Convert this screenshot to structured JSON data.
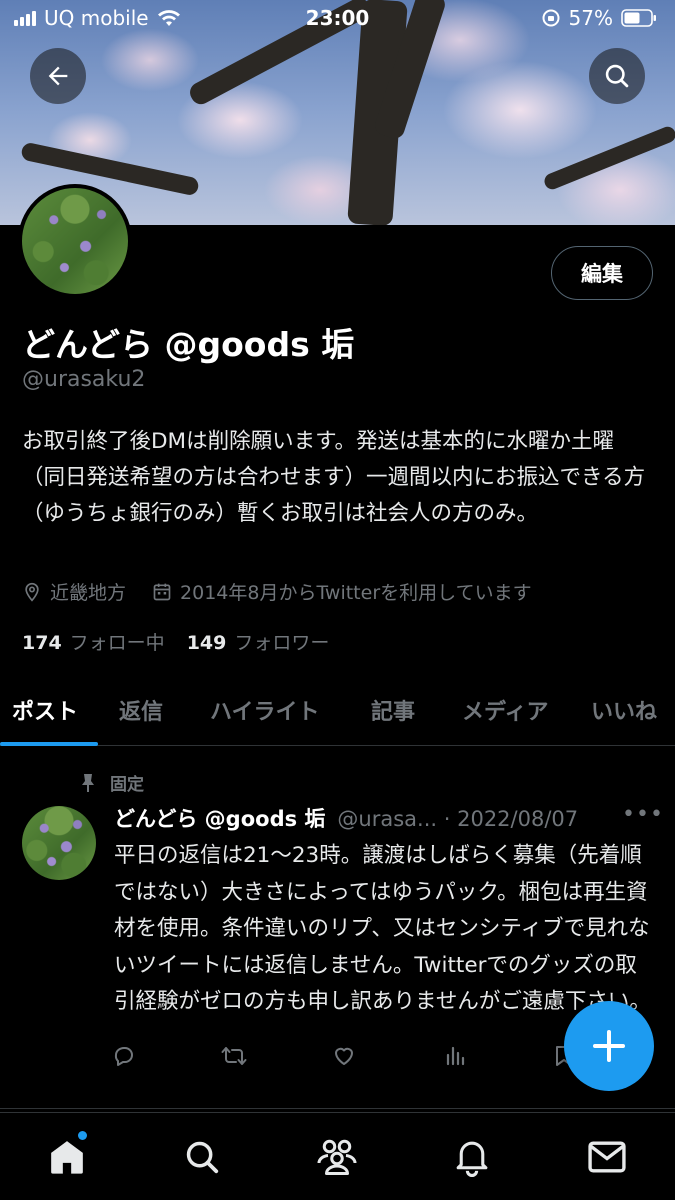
{
  "status_bar": {
    "carrier": "UQ mobile",
    "time": "23:00",
    "battery": "57%"
  },
  "profile": {
    "display_name": "どんどら @goods 垢",
    "handle": "@urasaku2",
    "edit_label": "編集",
    "bio": "お取引終了後DMは削除願います。発送は基本的に水曜か土曜（同日発送希望の方は合わせます）一週間以内にお振込できる方（ゆうちょ銀行のみ）暫くお取引は社会人の方のみ。",
    "location": "近畿地方",
    "joined": "2014年8月からTwitterを利用しています",
    "following_count": "174",
    "following_label": "フォロー中",
    "followers_count": "149",
    "followers_label": "フォロワー"
  },
  "tabs": [
    {
      "label": "ポスト",
      "active": true
    },
    {
      "label": "返信",
      "active": false
    },
    {
      "label": "ハイライト",
      "active": false
    },
    {
      "label": "記事",
      "active": false
    },
    {
      "label": "メディア",
      "active": false
    },
    {
      "label": "いいね",
      "active": false
    }
  ],
  "pinned_post": {
    "pinned_label": "固定",
    "author_name": "どんどら @goods 垢",
    "author_handle_date": "@urasa... · 2022/08/07",
    "more": "•••",
    "text": "平日の返信は21〜23時。譲渡はしばらく募集（先着順ではない）大きさによってはゆうパック。梱包は再生資材を使用。条件違いのリプ、又はセンシティブで見れないツイートには返信しません。Twitterでのグッズの取引経験がゼロの方も申し訳ありませんがご遠慮下さい。"
  },
  "icons": {
    "back": "arrow-left-icon",
    "search": "search-icon",
    "location": "location-pin-icon",
    "calendar": "calendar-icon",
    "pin": "pin-icon",
    "reply": "reply-icon",
    "retweet": "retweet-icon",
    "like": "heart-icon",
    "views": "views-icon",
    "share": "share-icon",
    "compose": "plus-icon",
    "home": "home-icon",
    "explore": "search-icon",
    "communities": "communities-icon",
    "notifications": "bell-icon",
    "messages": "mail-icon"
  },
  "colors": {
    "accent": "#1d9bf0",
    "background": "#000000",
    "muted": "#71767b"
  }
}
